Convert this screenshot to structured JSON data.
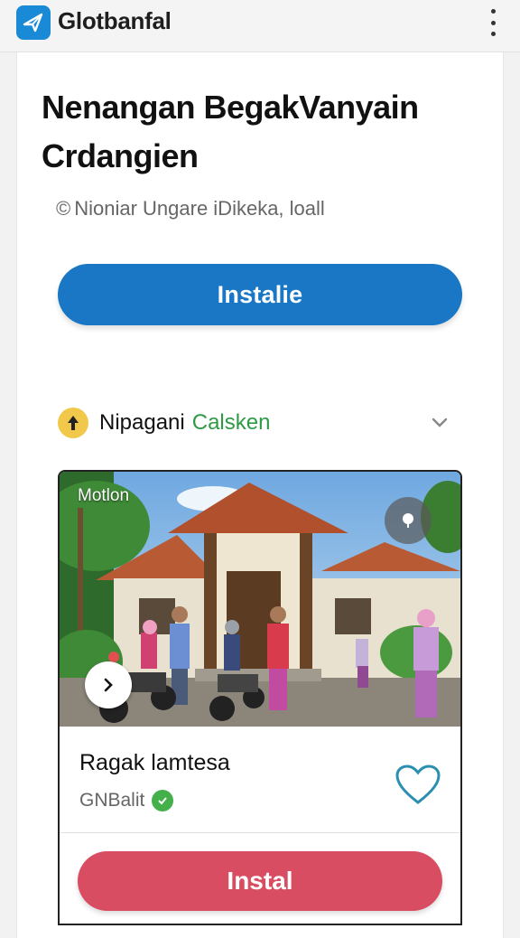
{
  "app": {
    "title": "Glotbanfal",
    "logo_icon": "plane-icon",
    "menu_icon": "more-vert-icon",
    "accent": "#1a8ad6"
  },
  "listing": {
    "title": "Nenangan BegakVanyain Crdangien",
    "subtitle": "Nioniar Ungare iDikeka, loall",
    "subtitle_icon": "copyright-icon",
    "install_label": "Instalie",
    "install_color": "#1977c5"
  },
  "section": {
    "label": "Nipagani",
    "accent_text": "Calsken",
    "accent_color": "#2f9a46",
    "icon": "arrow-up-icon",
    "toggle_icon": "chevron-down-icon"
  },
  "card": {
    "photo_label": "Motlon",
    "pin_icon": "pin-icon",
    "next_icon": "chevron-right-icon",
    "item_title": "Ragak lamtesa",
    "item_meta": "GNBalit",
    "meta_icon": "check-icon",
    "favorite_icon": "heart-icon",
    "install_label": "Instal",
    "install_color": "#d94d63"
  }
}
